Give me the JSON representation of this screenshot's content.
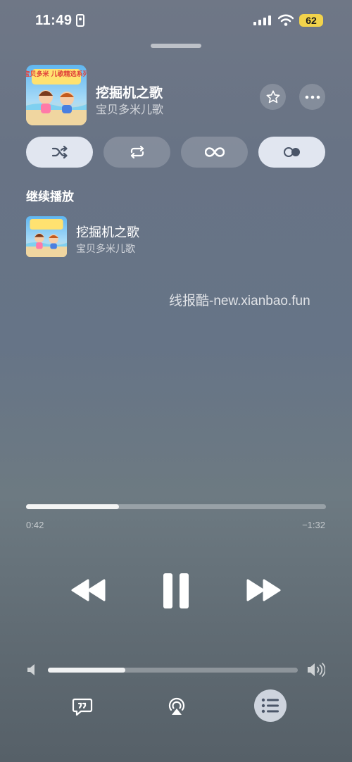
{
  "status_bar": {
    "time": "11:49",
    "battery": "62"
  },
  "now_playing": {
    "title": "挖掘机之歌",
    "artist": "宝贝多米儿歌",
    "album_art_caption": "宝贝多米 儿歌精选系列"
  },
  "modes": [
    {
      "name": "shuffle",
      "icon": "shuffle-icon",
      "active": true
    },
    {
      "name": "repeat",
      "icon": "repeat-icon",
      "active": false
    },
    {
      "name": "infinity",
      "icon": "infinity-icon",
      "active": false
    },
    {
      "name": "autoplay",
      "icon": "autoplay-toggle-icon",
      "active": true
    }
  ],
  "queue": {
    "heading": "继续播放",
    "items": [
      {
        "title": "挖掘机之歌",
        "artist": "宝贝多米儿歌"
      }
    ]
  },
  "watermark": "线报酷-new.xianbao.fun",
  "playback": {
    "elapsed": "0:42",
    "remaining": "−1:32",
    "progress": 0.31
  },
  "volume": {
    "level": 0.31
  },
  "colors": {
    "battery": "#f2d34b",
    "active_pill": "#ebf0fa"
  }
}
